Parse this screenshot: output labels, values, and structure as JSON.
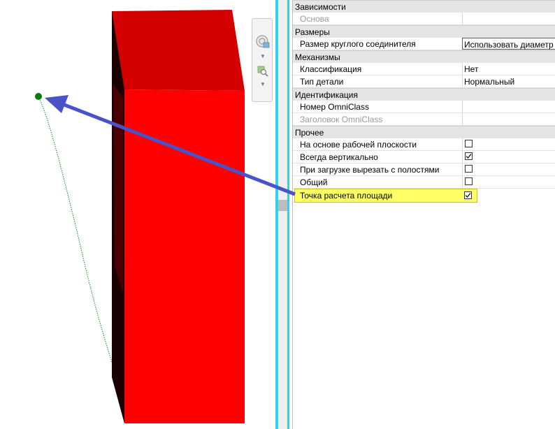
{
  "properties": {
    "groups": [
      {
        "title": "Зависимости",
        "rows": [
          {
            "name": "Основа",
            "value": "",
            "disabled": true
          }
        ]
      },
      {
        "title": "Размеры",
        "rows": [
          {
            "name": "Размер круглого соединителя",
            "value": "Использовать диаметр"
          }
        ]
      },
      {
        "title": "Механизмы",
        "rows": [
          {
            "name": "Классификация",
            "value": "Нет"
          },
          {
            "name": "Тип детали",
            "value": "Нормальный"
          }
        ]
      },
      {
        "title": "Идентификация",
        "rows": [
          {
            "name": "Номер OmniClass",
            "value": ""
          },
          {
            "name": "Заголовок OmniClass",
            "value": "",
            "disabled": true
          }
        ]
      },
      {
        "title": "Прочее",
        "rows": [
          {
            "name": "На основе рабочей плоскости",
            "checked": false
          },
          {
            "name": "Всегда вертикально",
            "checked": true
          },
          {
            "name": "При загрузке вырезать с полостями",
            "checked": false
          },
          {
            "name": "Общий",
            "checked": false
          },
          {
            "name": "Точка расчета площади",
            "checked": true,
            "highlighted": true
          }
        ]
      }
    ]
  },
  "navbar": {
    "icons": [
      "steering-wheel-icon",
      "zoom-icon"
    ]
  },
  "colors": {
    "block_face": "#ff0000",
    "block_top": "#d40000",
    "arrow": "#4a52c8",
    "highlight": "#ffff66",
    "point": "#0a7a0a"
  }
}
